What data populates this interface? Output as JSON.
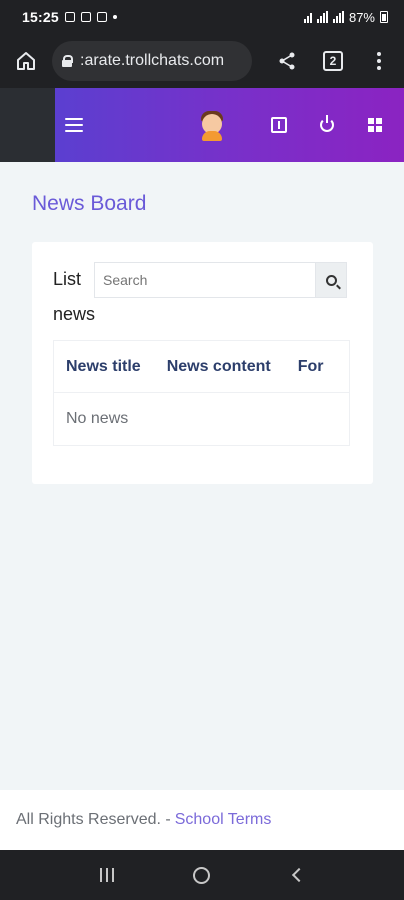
{
  "status_bar": {
    "time": "15:25",
    "battery": "87%"
  },
  "browser": {
    "url": ":arate.trollchats.com",
    "tab_count": "2"
  },
  "header": {
    "icons": [
      "menu-icon",
      "avatar",
      "translate-icon",
      "power-icon",
      "apps-grid-icon"
    ],
    "gradient_colors": [
      "#5b3fd0",
      "#8b23c2"
    ]
  },
  "page": {
    "title": "News Board"
  },
  "news_card": {
    "label": "List news",
    "search_placeholder": "Search",
    "table": {
      "columns": [
        "News title",
        "News content",
        "For"
      ],
      "empty_text": "No news"
    }
  },
  "footer": {
    "text": "All Rights Reserved. -",
    "link": "School Terms"
  },
  "colors": {
    "accent": "#6a5ad8",
    "background": "#f1f5f7"
  }
}
